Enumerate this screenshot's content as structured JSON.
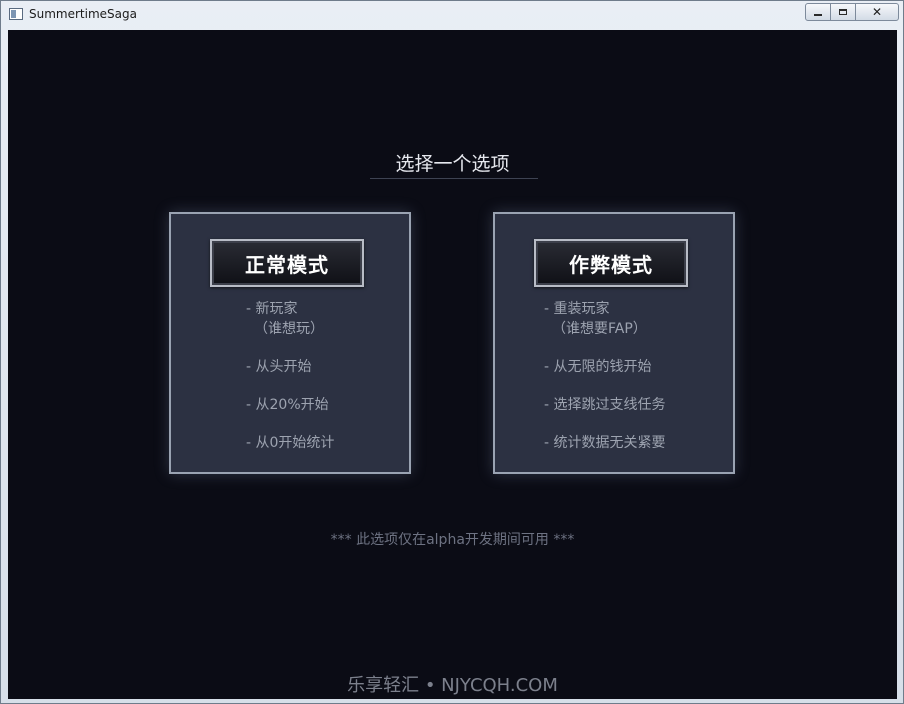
{
  "window": {
    "title": "SummertimeSaga",
    "icon": "app-window-icon",
    "controls": {
      "minimize": "minimize-icon",
      "maximize": "maximize-icon",
      "close": "close-icon"
    }
  },
  "screen": {
    "heading": "选择一个选项",
    "modes": [
      {
        "label": "正常模式",
        "features": [
          "- 新玩家",
          "（谁想玩）",
          "- 从头开始",
          "- 从20%开始",
          "- 从0开始统计"
        ]
      },
      {
        "label": "作弊模式",
        "features": [
          "- 重装玩家",
          "（谁想要FAP）",
          "- 从无限的钱开始",
          "- 选择跳过支线任务",
          "- 统计数据无关紧要"
        ]
      }
    ],
    "note": "***  此选项仅在alpha开发期间可用 ***",
    "watermark": "乐享轻汇 • NJYCQH.COM"
  },
  "colors": {
    "background": "#0b0c15",
    "panel": "#2c3142",
    "panel_border": "#9aa3b2",
    "text_feature": "#9da3b0"
  }
}
